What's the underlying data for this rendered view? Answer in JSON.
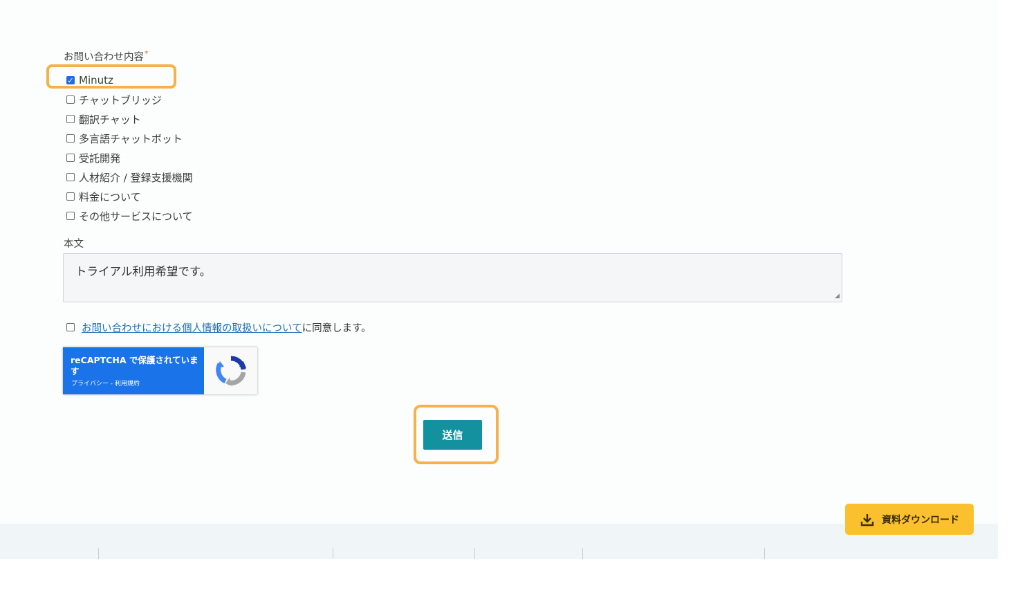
{
  "form": {
    "inquiry_label": "お問い合わせ内容",
    "required_mark": "*",
    "options": [
      {
        "label": "Minutz",
        "checked": true
      },
      {
        "label": "チャットブリッジ",
        "checked": false
      },
      {
        "label": "翻訳チャット",
        "checked": false
      },
      {
        "label": "多言語チャットボット",
        "checked": false
      },
      {
        "label": "受託開発",
        "checked": false
      },
      {
        "label": "人材紹介 / 登録支援機関",
        "checked": false
      },
      {
        "label": "料金について",
        "checked": false
      },
      {
        "label": "その他サービスについて",
        "checked": false
      }
    ],
    "body_label": "本文",
    "body_value": "トライアル利用希望です。",
    "privacy_link": "お問い合わせにおける個人情報の取扱いについて",
    "privacy_suffix": "に同意します。",
    "privacy_checked": false,
    "submit_label": "送信"
  },
  "recaptcha": {
    "text": "reCAPTCHA で保護されています",
    "privacy": "プライバシー",
    "separator": " - ",
    "terms": "利用規約"
  },
  "download_button": {
    "label": "資料ダウンロード",
    "icon": "download-icon"
  },
  "colors": {
    "accent": "#14919f",
    "highlight": "#f6b14c",
    "download": "#fbc02d",
    "recaptcha": "#1a73e8"
  }
}
